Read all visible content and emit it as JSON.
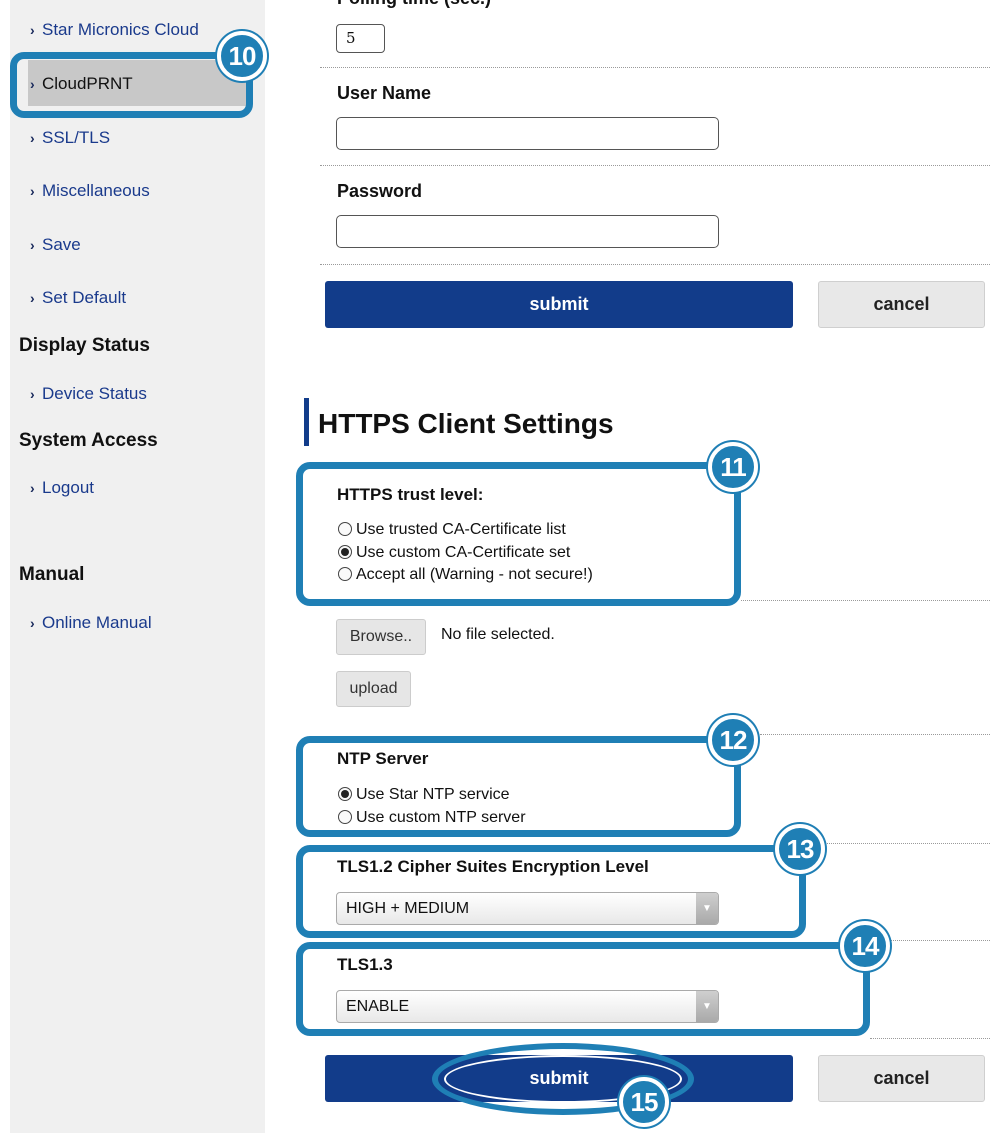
{
  "sidebar": {
    "items": [
      {
        "label": "Star Micronics Cloud"
      },
      {
        "label": "CloudPRNT"
      },
      {
        "label": "SSL/TLS"
      },
      {
        "label": "Miscellaneous"
      },
      {
        "label": "Save"
      },
      {
        "label": "Set Default"
      }
    ],
    "display_status": {
      "heading": "Display Status",
      "items": [
        {
          "label": "Device Status"
        }
      ]
    },
    "system_access": {
      "heading": "System Access",
      "items": [
        {
          "label": "Logout"
        }
      ]
    },
    "manual": {
      "heading": "Manual",
      "items": [
        {
          "label": "Online Manual"
        }
      ]
    }
  },
  "form_top": {
    "polling_time_label": "Polling time (sec.)",
    "polling_time_value": "5",
    "user_name_label": "User Name",
    "user_name_value": "",
    "password_label": "Password",
    "password_value": "",
    "submit_label": "submit",
    "cancel_label": "cancel"
  },
  "https": {
    "title": "HTTPS Client Settings",
    "trust_level_label": "HTTPS trust level:",
    "trust_options": [
      {
        "label": "Use trusted CA-Certificate list",
        "checked": false
      },
      {
        "label": "Use custom CA-Certificate set",
        "checked": true
      },
      {
        "label": "Accept all (Warning - not secure!)",
        "checked": false
      }
    ],
    "browse_label": "Browse..",
    "file_status": "No file selected.",
    "upload_label": "upload",
    "ntp_label": "NTP Server",
    "ntp_options": [
      {
        "label": "Use Star NTP service",
        "checked": true
      },
      {
        "label": "Use custom NTP server",
        "checked": false
      }
    ],
    "cipher_label": "TLS1.2 Cipher Suites Encryption Level",
    "cipher_value": "HIGH + MEDIUM",
    "tls13_label": "TLS1.3",
    "tls13_value": "ENABLE",
    "submit_label": "submit",
    "cancel_label": "cancel"
  },
  "callouts": {
    "c10": "10",
    "c11": "11",
    "c12": "12",
    "c13": "13",
    "c14": "14",
    "c15": "15"
  },
  "colors": {
    "accent": "#1f7fb5",
    "primary_button": "#123c8a",
    "sidebar_bg": "#f0f0f0"
  },
  "icons": {
    "nav_chevron": "chevron-right-icon",
    "dropdown_arrow": "chevron-down-icon"
  }
}
